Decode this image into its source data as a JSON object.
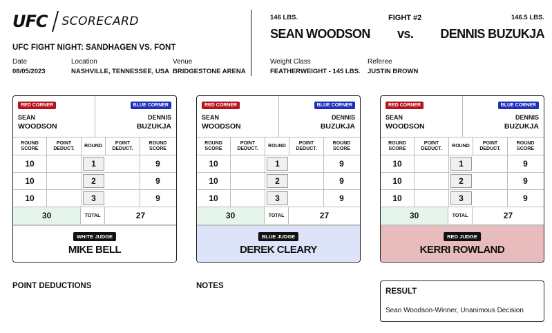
{
  "brand": {
    "logo": "UFC",
    "title": "SCORECARD"
  },
  "event": {
    "name": "UFC FIGHT NIGHT: SANDHAGEN VS. FONT",
    "date_label": "Date",
    "date": "08/05/2023",
    "location_label": "Location",
    "location": "NASHVILLE, TENNESSEE, USA",
    "venue_label": "Venue",
    "venue": "BRIDGESTONE ARENA"
  },
  "fight": {
    "number": "FIGHT #2",
    "vs": "vs.",
    "red": {
      "weight": "146 LBS.",
      "name": "SEAN WOODSON"
    },
    "blue": {
      "weight": "146.5 LBS.",
      "name": "DENNIS BUZUKJA"
    },
    "weight_class_label": "Weight Class",
    "weight_class": "FEATHERWEIGHT - 145 LBS.",
    "referee_label": "Referee",
    "referee": "JUSTIN BROWN"
  },
  "card_labels": {
    "red_corner": "RED CORNER",
    "blue_corner": "BLUE CORNER",
    "red_first": "SEAN",
    "red_last": "WOODSON",
    "blue_first": "DENNIS",
    "blue_last": "BUZUKJA",
    "col_round_score": "ROUND SCORE",
    "col_point_deduct": "POINT DEDUCT.",
    "col_round": "ROUND",
    "total": "TOTAL"
  },
  "judges": [
    {
      "tag": "WHITE JUDGE",
      "name": "MIKE BELL",
      "bg": "#ffffff",
      "rounds": [
        {
          "r": "1",
          "red": "10",
          "blue": "9"
        },
        {
          "r": "2",
          "red": "10",
          "blue": "9"
        },
        {
          "r": "3",
          "red": "10",
          "blue": "9"
        }
      ],
      "total_red": "30",
      "total_blue": "27"
    },
    {
      "tag": "BLUE JUDGE",
      "name": "DEREK CLEARY",
      "bg": "#dde3f8",
      "rounds": [
        {
          "r": "1",
          "red": "10",
          "blue": "9"
        },
        {
          "r": "2",
          "red": "10",
          "blue": "9"
        },
        {
          "r": "3",
          "red": "10",
          "blue": "9"
        }
      ],
      "total_red": "30",
      "total_blue": "27"
    },
    {
      "tag": "RED JUDGE",
      "name": "KERRI ROWLAND",
      "bg": "#e8bcbc",
      "rounds": [
        {
          "r": "1",
          "red": "10",
          "blue": "9"
        },
        {
          "r": "2",
          "red": "10",
          "blue": "9"
        },
        {
          "r": "3",
          "red": "10",
          "blue": "9"
        }
      ],
      "total_red": "30",
      "total_blue": "27"
    }
  ],
  "sections": {
    "point_deductions": "POINT DEDUCTIONS",
    "notes": "NOTES"
  },
  "result": {
    "title": "RESULT",
    "text": "Sean Woodson-Winner, Unanimous Decision"
  },
  "colors": {
    "red_corner": "#b5121b",
    "blue_corner": "#1d2fb8",
    "total_highlight": "#e6f5ec"
  }
}
